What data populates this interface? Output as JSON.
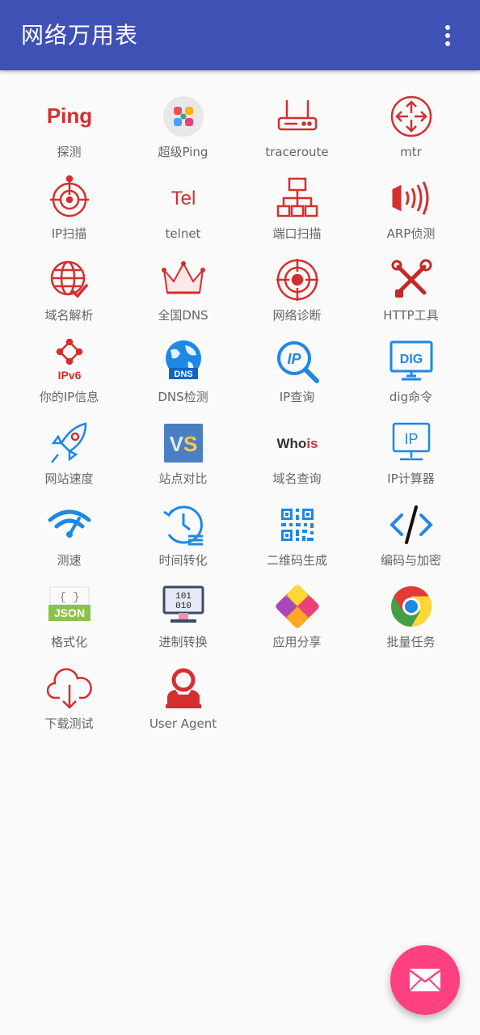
{
  "app": {
    "title": "网络万用表",
    "colors": {
      "appbar": "#3f51b5",
      "fab": "#ff4081",
      "icon_red": "#d32f2f",
      "icon_blue": "#1e88e5"
    }
  },
  "tools": [
    {
      "label": "探测",
      "icon": "ping-text-icon"
    },
    {
      "label": "超级Ping",
      "icon": "super-ping-icon"
    },
    {
      "label": "traceroute",
      "icon": "router-icon"
    },
    {
      "label": "mtr",
      "icon": "network-node-icon"
    },
    {
      "label": "IP扫描",
      "icon": "radar-target-icon"
    },
    {
      "label": "telnet",
      "icon": "tel-text-icon"
    },
    {
      "label": "端口扫描",
      "icon": "network-tree-icon"
    },
    {
      "label": "ARP侦测",
      "icon": "signal-waves-icon"
    },
    {
      "label": "域名解析",
      "icon": "globe-check-icon"
    },
    {
      "label": "全国DNS",
      "icon": "crown-icon"
    },
    {
      "label": "网络诊断",
      "icon": "crosshair-icon"
    },
    {
      "label": "HTTP工具",
      "icon": "tools-icon"
    },
    {
      "label": "你的IP信息",
      "icon": "ipv6-icon",
      "icon_text": "IPv6"
    },
    {
      "label": "DNS检测",
      "icon": "dns-globe-icon",
      "icon_text": "DNS"
    },
    {
      "label": "IP查询",
      "icon": "ip-search-icon",
      "icon_text": "IP"
    },
    {
      "label": "dig命令",
      "icon": "dig-monitor-icon",
      "icon_text": "DIG"
    },
    {
      "label": "网站速度",
      "icon": "rocket-icon"
    },
    {
      "label": "站点对比",
      "icon": "vs-icon",
      "icon_text": "VS"
    },
    {
      "label": "域名查询",
      "icon": "whois-text-icon",
      "icon_text": "Whois"
    },
    {
      "label": "IP计算器",
      "icon": "ip-monitor-icon",
      "icon_text": "IP"
    },
    {
      "label": "测速",
      "icon": "wifi-speed-icon"
    },
    {
      "label": "时间转化",
      "icon": "clock-history-icon"
    },
    {
      "label": "二维码生成",
      "icon": "qr-code-icon"
    },
    {
      "label": "编码与加密",
      "icon": "code-tag-icon"
    },
    {
      "label": "格式化",
      "icon": "json-icon",
      "icon_text": "JSON"
    },
    {
      "label": "进制转换",
      "icon": "binary-monitor-icon",
      "icon_text_1": "101",
      "icon_text_2": "010"
    },
    {
      "label": "应用分享",
      "icon": "share-app-icon"
    },
    {
      "label": "批量任务",
      "icon": "chrome-icon"
    },
    {
      "label": "下载测试",
      "icon": "cloud-download-icon"
    },
    {
      "label": "User Agent",
      "icon": "user-agent-icon"
    }
  ],
  "ping_icon_text": "Ping",
  "tel_icon_text": "Tel"
}
